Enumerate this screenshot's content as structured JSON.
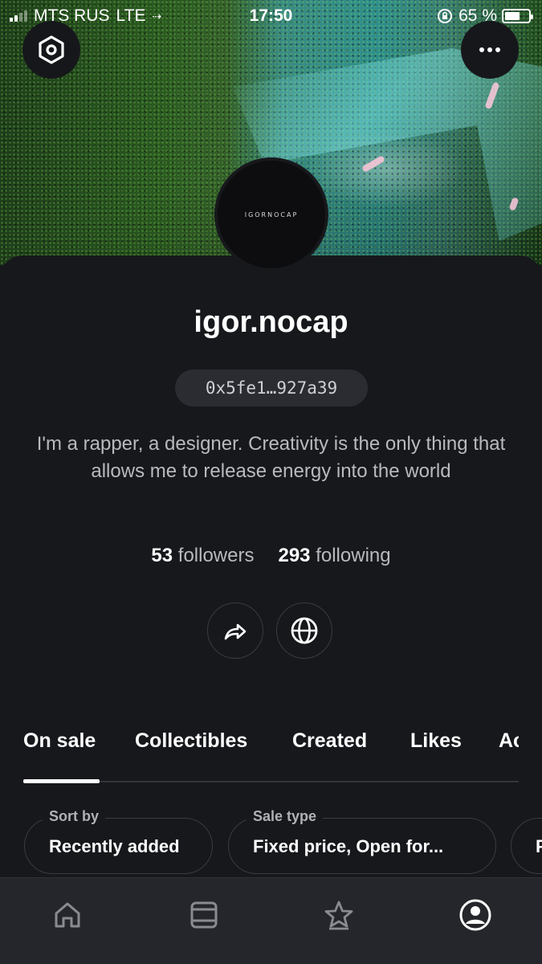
{
  "status_bar": {
    "carrier": "MTS RUS",
    "network": "LTE",
    "time": "17:50",
    "battery_text": "65 %",
    "battery_level": 0.65
  },
  "profile": {
    "avatar_text": "IGORNOCAP",
    "username": "igor.nocap",
    "wallet": "0x5fe1…927a39",
    "bio": "I'm a rapper, a designer. Creativity is the only thing that allows me to release energy into the world",
    "followers_count": "53",
    "followers_label": "followers",
    "following_count": "293",
    "following_label": "following"
  },
  "tabs": [
    {
      "label": "On sale",
      "active": true
    },
    {
      "label": "Collectibles",
      "active": false
    },
    {
      "label": "Created",
      "active": false
    },
    {
      "label": "Likes",
      "active": false
    },
    {
      "label": "Ac",
      "active": false
    }
  ],
  "filters": {
    "sort_label": "Sort by",
    "sort_value": "Recently added",
    "sale_label": "Sale type",
    "sale_value": "Fixed price, Open for...",
    "third_value": "F"
  },
  "icons": {
    "settings": "settings-hex-icon",
    "more": "more-dots-icon",
    "share": "share-arrow-icon",
    "website": "globe-icon",
    "home": "home-icon",
    "gallery": "gallery-icon",
    "favorites": "star-icon",
    "profile": "profile-icon"
  },
  "colors": {
    "background": "#17181c",
    "pill": "#2b2c31",
    "nav": "#25262b"
  }
}
